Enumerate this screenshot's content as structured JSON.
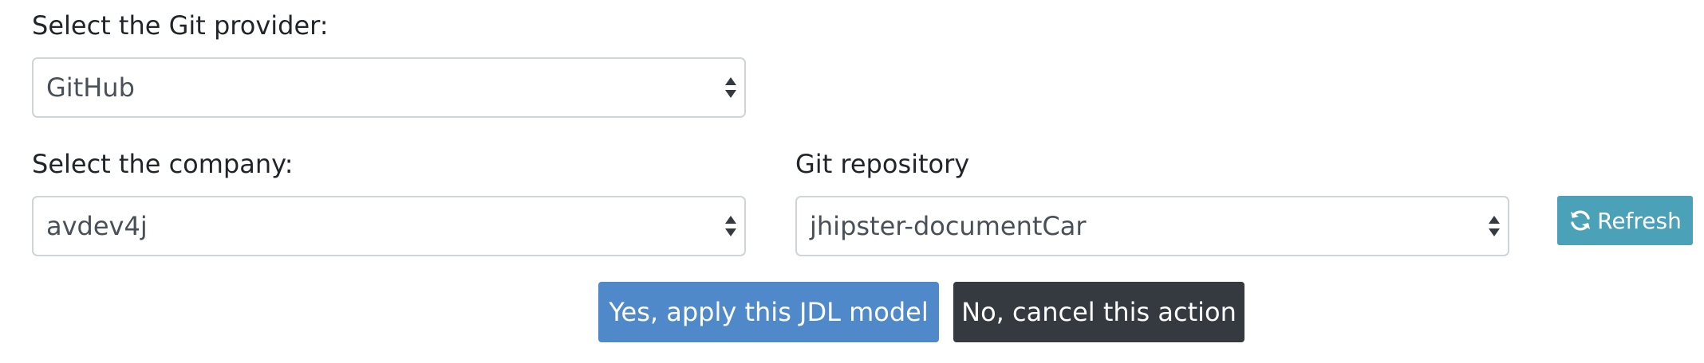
{
  "git_provider": {
    "label": "Select the Git provider:",
    "selected": "GitHub"
  },
  "company": {
    "label": "Select the company:",
    "selected": "avdev4j"
  },
  "repository": {
    "label": "Git repository",
    "selected": "jhipster-documentCar"
  },
  "refresh_button": {
    "label": "Refresh",
    "icon": "refresh-icon",
    "color": "#4ba2b8"
  },
  "actions": {
    "apply_label": "Yes, apply this JDL model",
    "apply_color": "#4f89c9",
    "cancel_label": "No, cancel this action",
    "cancel_color": "#343a40"
  }
}
